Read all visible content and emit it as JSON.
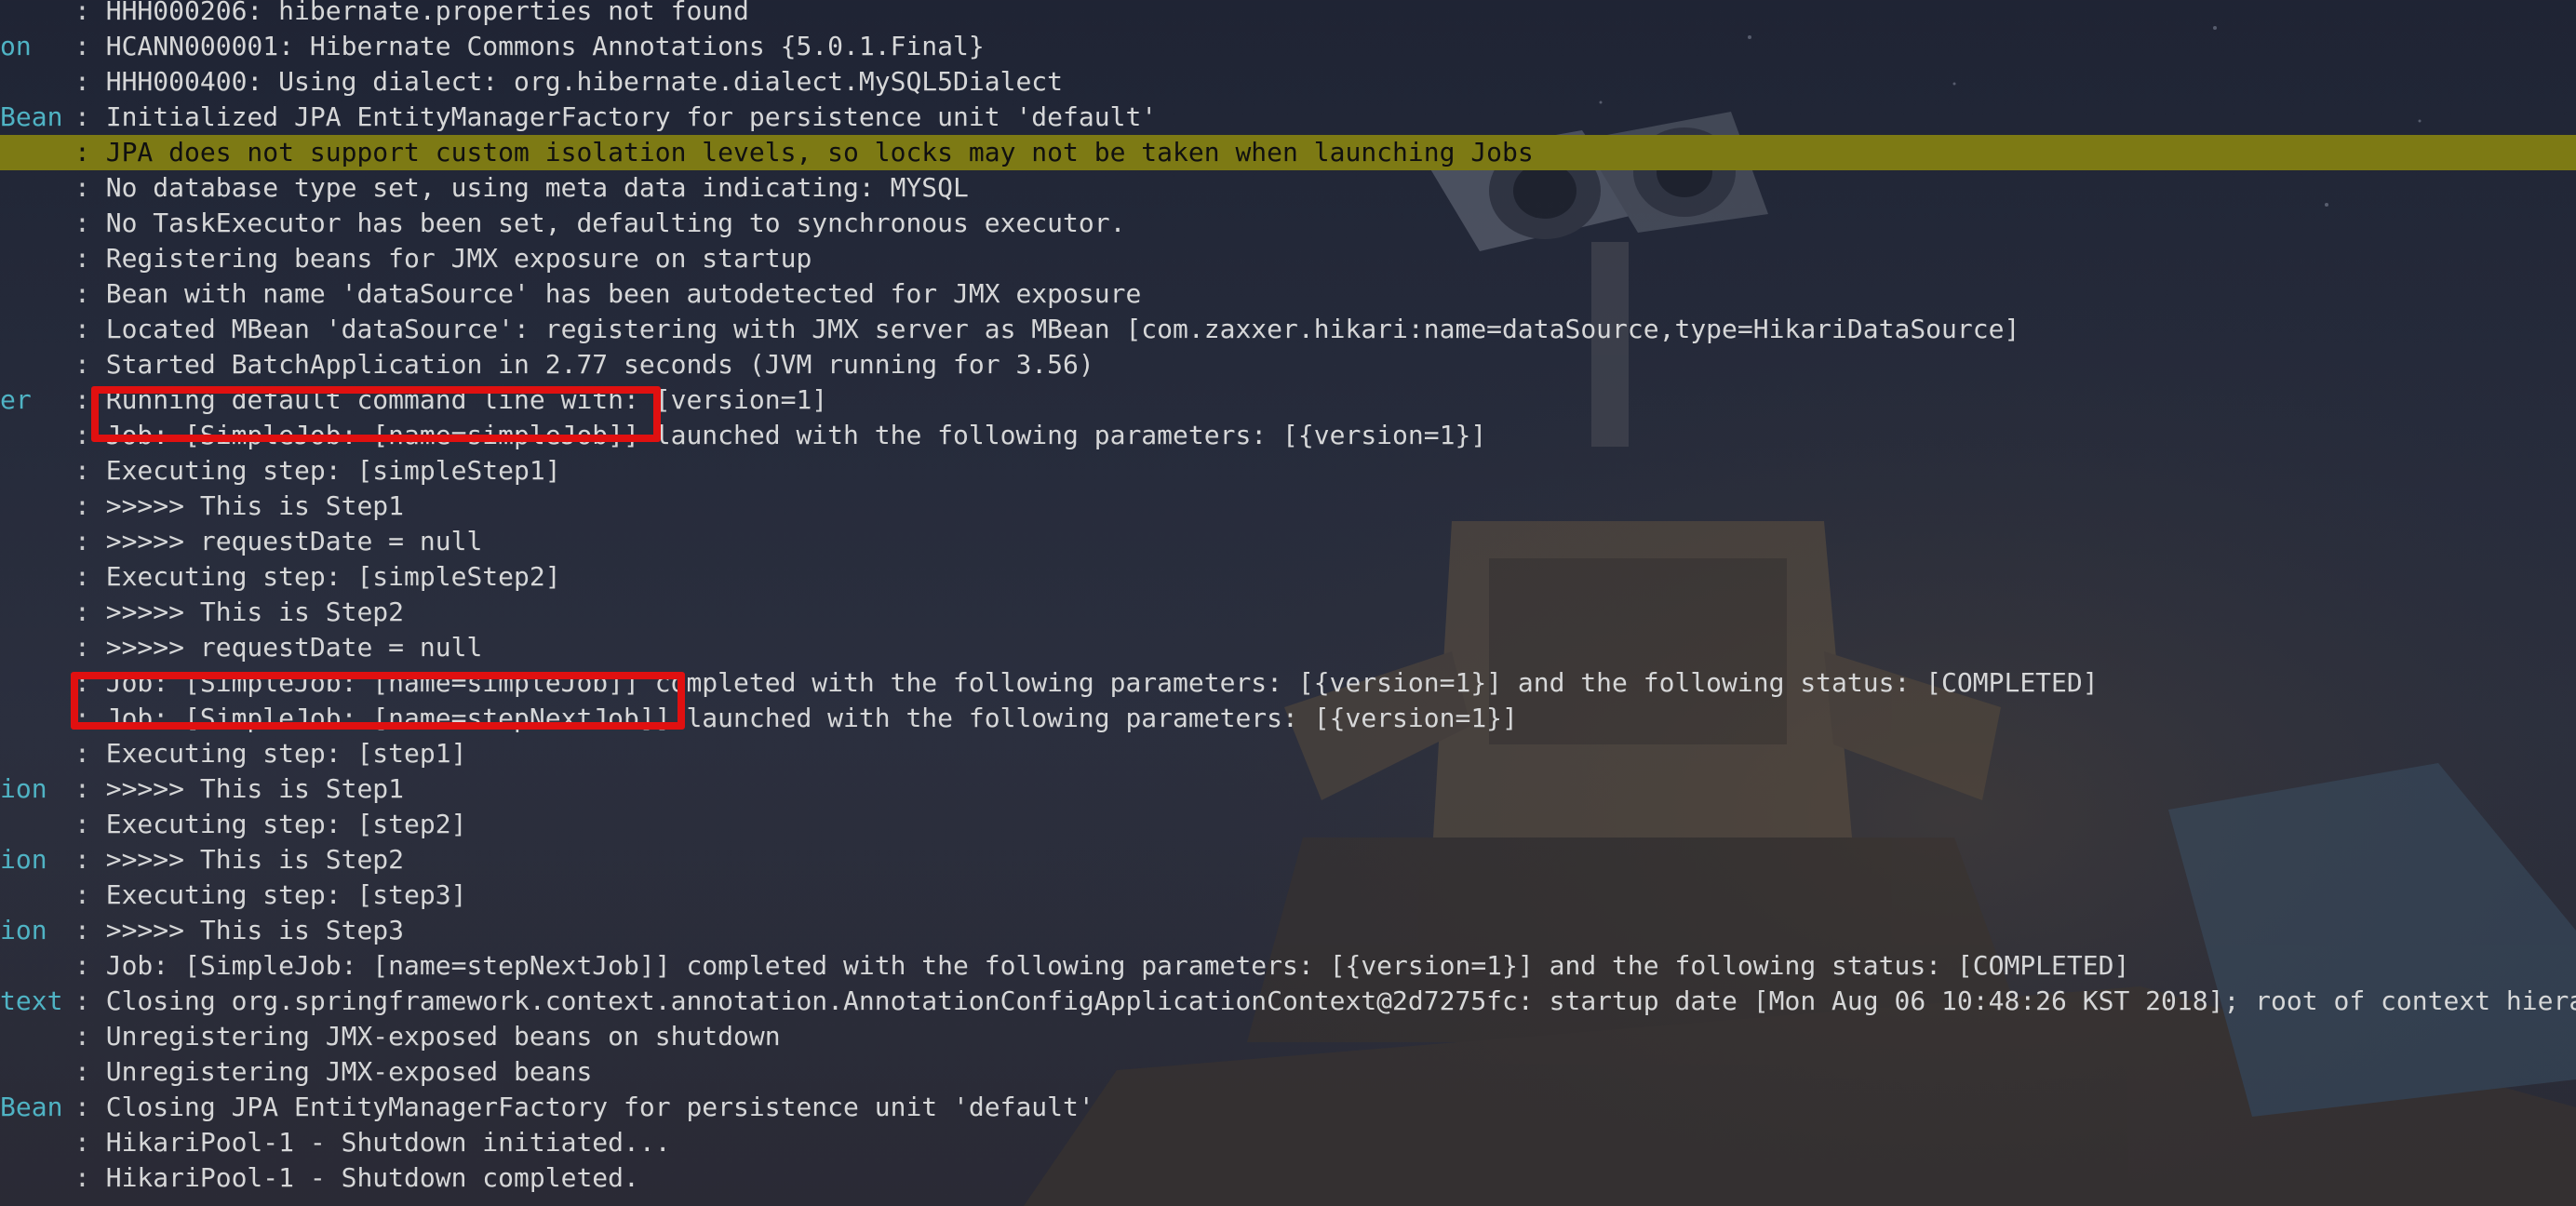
{
  "terminal": {
    "theme": {
      "background": "#252a39",
      "text": "#d6d7d8",
      "logger_name": "#4fb3c4",
      "warn_highlight": "#7d7a14",
      "annotation_border": "#e01010"
    },
    "lines": [
      {
        "logger": "",
        "message": "HHH000206: hibernate.properties not found"
      },
      {
        "logger": "on",
        "message": "HCANN000001: Hibernate Commons Annotations {5.0.1.Final}"
      },
      {
        "logger": "",
        "message": "HHH000400: Using dialect: org.hibernate.dialect.MySQL5Dialect"
      },
      {
        "logger": "Bean",
        "message": "Initialized JPA EntityManagerFactory for persistence unit 'default'"
      },
      {
        "logger": "",
        "message": "JPA does not support custom isolation levels, so locks may not be taken when launching Jobs",
        "level": "warn"
      },
      {
        "logger": "",
        "message": "No database type set, using meta data indicating: MYSQL"
      },
      {
        "logger": "",
        "message": "No TaskExecutor has been set, defaulting to synchronous executor."
      },
      {
        "logger": "",
        "message": "Registering beans for JMX exposure on startup"
      },
      {
        "logger": "",
        "message": "Bean with name 'dataSource' has been autodetected for JMX exposure"
      },
      {
        "logger": "",
        "message": "Located MBean 'dataSource': registering with JMX server as MBean [com.zaxxer.hikari:name=dataSource,type=HikariDataSource]"
      },
      {
        "logger": "",
        "message": "Started BatchApplication in 2.77 seconds (JVM running for 3.56)"
      },
      {
        "logger": "er",
        "message": "Running default command line with: [version=1]"
      },
      {
        "logger": "",
        "message": "Job: [SimpleJob: [name=simpleJob]] launched with the following parameters: [{version=1}]"
      },
      {
        "logger": "",
        "message": "Executing step: [simpleStep1]"
      },
      {
        "logger": "",
        "message": ">>>>> This is Step1"
      },
      {
        "logger": "",
        "message": ">>>>> requestDate = null"
      },
      {
        "logger": "",
        "message": "Executing step: [simpleStep2]"
      },
      {
        "logger": "",
        "message": ">>>>> This is Step2"
      },
      {
        "logger": "",
        "message": ">>>>> requestDate = null"
      },
      {
        "logger": "",
        "message": "Job: [SimpleJob: [name=simpleJob]] completed with the following parameters: [{version=1}] and the following status: [COMPLETED]"
      },
      {
        "logger": "",
        "message": "Job: [SimpleJob: [name=stepNextJob]] launched with the following parameters: [{version=1}]"
      },
      {
        "logger": "",
        "message": "Executing step: [step1]"
      },
      {
        "logger": "ion",
        "message": ">>>>> This is Step1"
      },
      {
        "logger": "",
        "message": "Executing step: [step2]"
      },
      {
        "logger": "ion",
        "message": ">>>>> This is Step2"
      },
      {
        "logger": "",
        "message": "Executing step: [step3]"
      },
      {
        "logger": "ion",
        "message": ">>>>> This is Step3"
      },
      {
        "logger": "",
        "message": "Job: [SimpleJob: [name=stepNextJob]] completed with the following parameters: [{version=1}] and the following status: [COMPLETED]"
      },
      {
        "logger": "text",
        "message": "Closing org.springframework.context.annotation.AnnotationConfigApplicationContext@2d7275fc: startup date [Mon Aug 06 10:48:26 KST 2018]; root of context hierarchy"
      },
      {
        "logger": "",
        "message": "Unregistering JMX-exposed beans on shutdown"
      },
      {
        "logger": "",
        "message": "Unregistering JMX-exposed beans"
      },
      {
        "logger": "Bean",
        "message": "Closing JPA EntityManagerFactory for persistence unit 'default'"
      },
      {
        "logger": "",
        "message": "HikariPool-1 - Shutdown initiated..."
      },
      {
        "logger": "",
        "message": "HikariPool-1 - Shutdown completed."
      }
    ]
  }
}
